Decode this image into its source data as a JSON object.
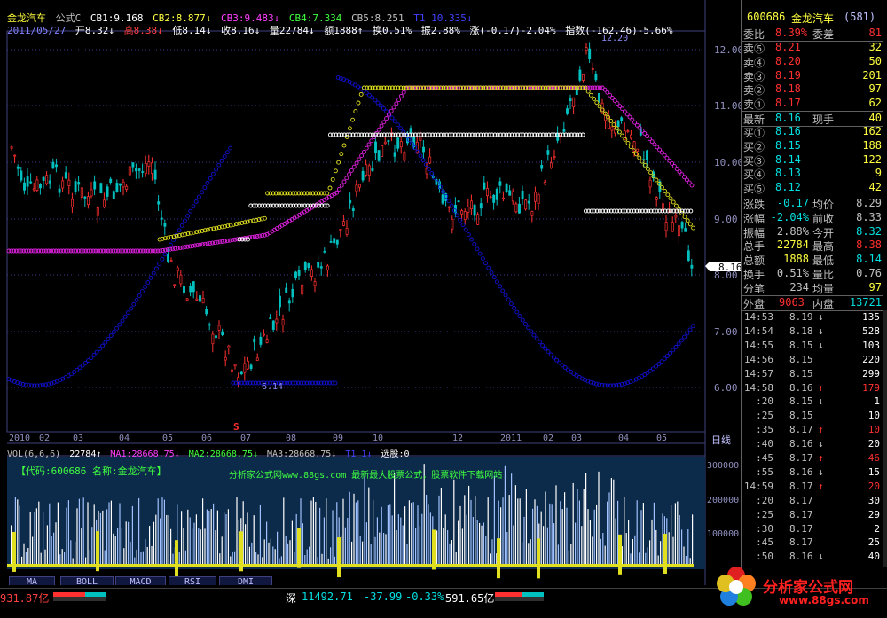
{
  "header": {
    "line1": [
      "金龙汽车",
      "公式C",
      "CB1:9.168",
      "CB2:8.877↓",
      "CB3:9.483↓",
      "CB4:7.334",
      "CB5:8.251",
      "T1 10.335↓"
    ],
    "line2_date": "2011/05/27",
    "line2": [
      "开8.32↓",
      "高8.38↓",
      "低8.14↓",
      "收8.16↓",
      "量22784↓",
      "额1888↑",
      "换0.51%",
      "振2.88%",
      "涨(-0.17)-2.04%",
      "指数(-162.46)-5.66%"
    ]
  },
  "chart": {
    "y_ticks": [
      "12.00",
      "11.00",
      "10.00",
      "9.00",
      "8.00",
      "7.00",
      "6.00"
    ],
    "x_ticks": [
      "2010",
      "02",
      "03",
      "04",
      "05",
      "06",
      "07",
      "08",
      "09",
      "10",
      "12",
      "2011",
      "02",
      "03",
      "04",
      "05"
    ],
    "annotations": {
      "high": "12.20",
      "low": "6.14",
      "current": "8.16",
      "s_marker": "S"
    },
    "right_tab": "日线",
    "vol_header": [
      "VOL(6,6,6)",
      "22784↑",
      "MA1:28668.75↓",
      "MA2:28668.75↓",
      "MA3:28668.75↓",
      "T1 1↓",
      "选股:0"
    ],
    "vol_ticks": [
      "300000",
      "200000",
      "100000"
    ],
    "overlay_left": "【代码:600686 名称:金龙汽车】",
    "overlay_center": "分析家公式网www.88gs.com 最新最大股票公式，股票软件下载网站"
  },
  "tabs": [
    "MA",
    "BOLL",
    "MACD",
    "RSI",
    "DMI"
  ],
  "side": {
    "code": "600686",
    "name": "金龙汽车",
    "num": "(581)",
    "weibi": {
      "label": "委比",
      "pct": "8.39%",
      "label2": "委差",
      "val": "81"
    },
    "asks": [
      {
        "label": "卖⑤",
        "price": "8.21",
        "vol": "32"
      },
      {
        "label": "卖④",
        "price": "8.20",
        "vol": "50"
      },
      {
        "label": "卖③",
        "price": "8.19",
        "vol": "201"
      },
      {
        "label": "卖②",
        "price": "8.18",
        "vol": "97"
      },
      {
        "label": "卖①",
        "price": "8.17",
        "vol": "62"
      }
    ],
    "last": {
      "label": "最新",
      "price": "8.16",
      "label2": "现手",
      "vol": "40"
    },
    "bids": [
      {
        "label": "买①",
        "price": "8.16",
        "vol": "162"
      },
      {
        "label": "买②",
        "price": "8.15",
        "vol": "188"
      },
      {
        "label": "买③",
        "price": "8.14",
        "vol": "122"
      },
      {
        "label": "买④",
        "price": "8.13",
        "vol": "9"
      },
      {
        "label": "买⑤",
        "price": "8.12",
        "vol": "42"
      }
    ],
    "stats": [
      {
        "l1": "涨跌",
        "v1": "-0.17",
        "l2": "均价",
        "v2": "8.29"
      },
      {
        "l1": "涨幅",
        "v1": "-2.04%",
        "l2": "前收",
        "v2": "8.33"
      },
      {
        "l1": "振幅",
        "v1": "2.88%",
        "l2": "今开",
        "v2": "8.32"
      },
      {
        "l1": "总手",
        "v1": "22784",
        "l2": "最高",
        "v2": "8.38"
      },
      {
        "l1": "总额",
        "v1": "1888",
        "l2": "最低",
        "v2": "8.14"
      },
      {
        "l1": "换手",
        "v1": "0.51%",
        "l2": "量比",
        "v2": "0.76"
      },
      {
        "l1": "分笔",
        "v1": "234",
        "l2": "均量",
        "v2": "97"
      }
    ],
    "outer": {
      "l1": "外盘",
      "v1": "9063",
      "l2": "内盘",
      "v2": "13721"
    },
    "ticks": [
      {
        "t": "14:53",
        "p": "8.19",
        "d": "↓",
        "v": "135"
      },
      {
        "t": "14:54",
        "p": "8.18",
        "d": "↓",
        "v": "528"
      },
      {
        "t": "14:55",
        "p": "8.15",
        "d": "↓",
        "v": "103"
      },
      {
        "t": "14:56",
        "p": "8.15",
        "d": "",
        "v": "220"
      },
      {
        "t": "14:57",
        "p": "8.15",
        "d": "",
        "v": "299"
      },
      {
        "t": "14:58",
        "p": "8.16",
        "d": "↑",
        "v": "179"
      },
      {
        "t": ":20",
        "p": "8.15",
        "d": "↓",
        "v": "1"
      },
      {
        "t": ":25",
        "p": "8.15",
        "d": "",
        "v": "10"
      },
      {
        "t": ":35",
        "p": "8.17",
        "d": "↑",
        "v": "10"
      },
      {
        "t": ":40",
        "p": "8.16",
        "d": "↓",
        "v": "20"
      },
      {
        "t": ":45",
        "p": "8.17",
        "d": "↑",
        "v": "46"
      },
      {
        "t": ":55",
        "p": "8.16",
        "d": "↓",
        "v": "15"
      },
      {
        "t": "14:59",
        "p": "8.17",
        "d": "↑",
        "v": "20"
      },
      {
        "t": ":20",
        "p": "8.17",
        "d": "",
        "v": "30"
      },
      {
        "t": ":25",
        "p": "8.17",
        "d": "",
        "v": "29"
      },
      {
        "t": ":30",
        "p": "8.17",
        "d": "",
        "v": "2"
      },
      {
        "t": ":45",
        "p": "8.17",
        "d": "",
        "v": "25"
      },
      {
        "t": ":50",
        "p": "8.16",
        "d": "↓",
        "v": "40"
      }
    ]
  },
  "bottom": {
    "left_value": "931.87亿",
    "shen_label": "深",
    "shen_index": "11492.71",
    "shen_change": "-37.99",
    "shen_pct": "-0.33%",
    "shen_amount": "591.65亿"
  },
  "watermark": {
    "line1": "分析家公式网",
    "line2": "www.88gs.com"
  },
  "colors": {
    "up": "#ff3030",
    "down": "#00c0c0",
    "blue_line": "#1010c0",
    "magenta": "#e020e0",
    "yellow": "#e0e020",
    "white": "#ffffff"
  }
}
